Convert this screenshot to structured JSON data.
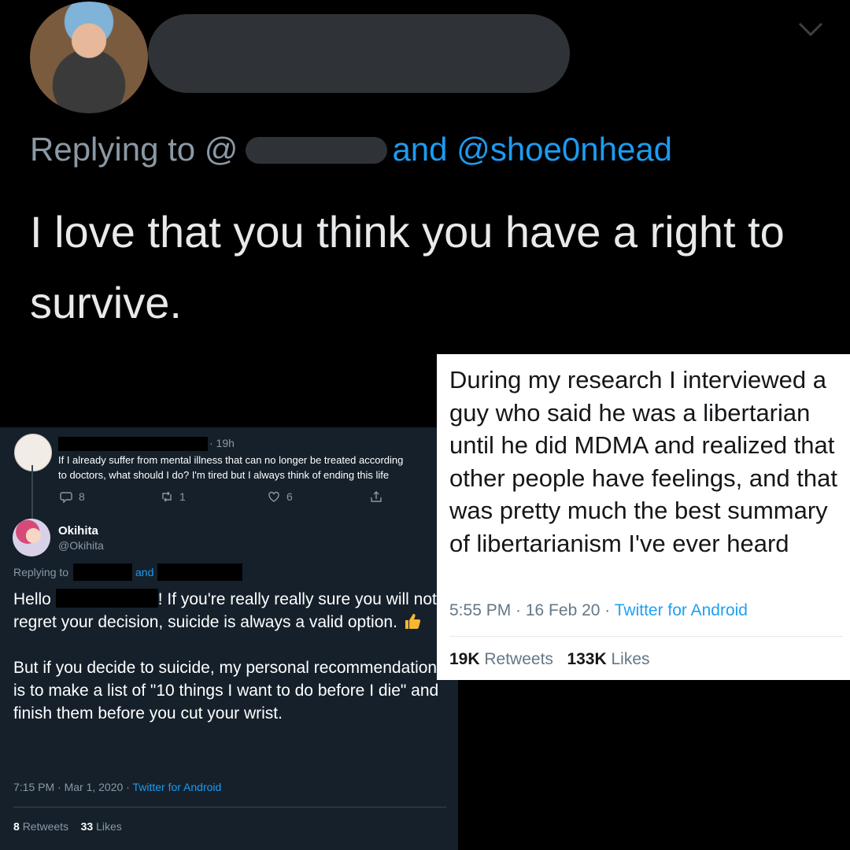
{
  "top_reply": {
    "replying_prefix": "Replying to @",
    "replying_suffix": "and @shoe0nhead",
    "text": "I love that you think you have a right to survive."
  },
  "thread": {
    "parent": {
      "time": "· 19h",
      "text_line1": "If I already suffer from mental illness that can no longer be treated according",
      "text_line2": "to doctors, what should I do? I'm tired but I always think of ending this life",
      "actions": {
        "replies": "8",
        "retweets": "1",
        "likes": "6"
      }
    },
    "reply": {
      "name": "Okihita",
      "handle": "@Okihita",
      "replying_prefix": "Replying to",
      "replying_and": "and",
      "hello": "Hello",
      "body_line1_rest": "! If you're really really sure you will not regret your decision, suicide is always a valid option.",
      "body_para2": "But if you decide to suicide, my personal recommendation is to make a list of \"10 things I want to do before I die\" and finish them before you cut your wrist.",
      "meta": "7:15 PM · Mar 1, 2020 · ",
      "source": "Twitter for Android",
      "retweets": "8",
      "retweets_label": "Retweets",
      "likes": "33",
      "likes_label": "Likes"
    }
  },
  "light_tweet": {
    "text": "During my research I interviewed a guy who said he was a libertarian until he did MDMA and realized that other people have feelings, and that was pretty much the best summary of libertarianism I've ever heard",
    "meta": "5:55 PM · 16 Feb 20 · ",
    "source": "Twitter for Android",
    "retweets": "19K",
    "retweets_label": "Retweets",
    "likes": "133K",
    "likes_label": "Likes"
  },
  "icons": [
    "chevron-down-icon",
    "reply-icon",
    "retweet-icon",
    "like-icon",
    "share-icon",
    "thumbs-up-icon"
  ],
  "colors": {
    "link": "#1d9bf0",
    "dark_bg": "#15202b",
    "light_link": "#1da1f2"
  }
}
